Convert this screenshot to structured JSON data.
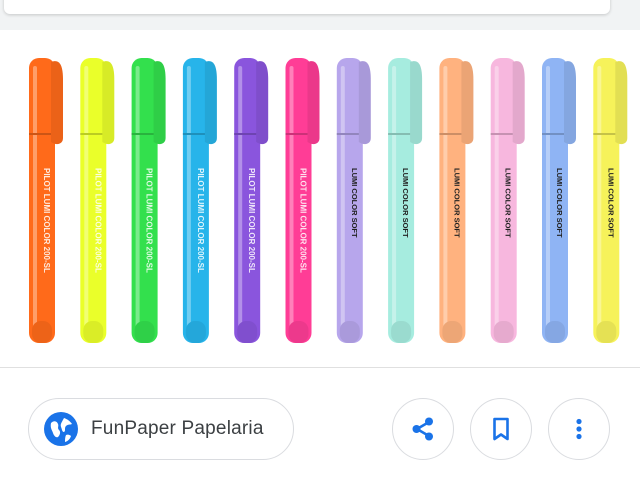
{
  "source": {
    "name": "FunPaper Papelaria",
    "icon": "globe-icon"
  },
  "actions": [
    {
      "name": "share",
      "icon": "share-icon"
    },
    {
      "name": "save",
      "icon": "bookmark-icon"
    },
    {
      "name": "more",
      "icon": "more-vert-icon"
    }
  ],
  "image": {
    "subject": "highlighter-pens",
    "pen_labels": {
      "rows_a": "PILOT LUMI COLOR 200-SL",
      "rows_b": "LUMI COLOR SOFT"
    },
    "pen_colors": [
      "#ff6a1a",
      "#eaff2a",
      "#33e04d",
      "#27b4ea",
      "#8a55dd",
      "#ff3d96",
      "#b7a6ec",
      "#a6ecdf",
      "#ffb27f",
      "#f7b7de",
      "#8fb4f4",
      "#f6f25a"
    ]
  },
  "colors": {
    "accent": "#1a73e8",
    "chip_border": "#dadce0",
    "text": "#3c4043"
  }
}
